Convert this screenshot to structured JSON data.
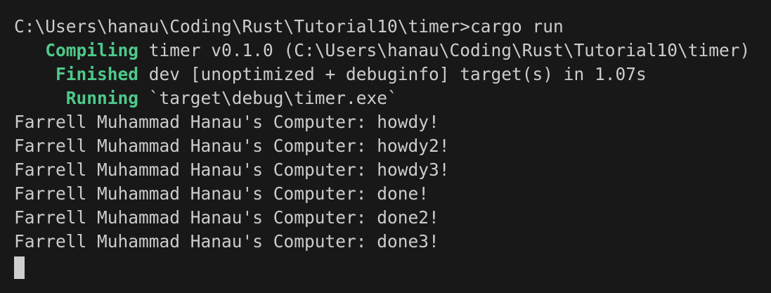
{
  "terminal": {
    "prompt": "C:\\Users\\hanau\\Coding\\Rust\\Tutorial10\\timer>cargo run",
    "cargo_lines": [
      {
        "indent": "   ",
        "status": "Compiling",
        "text": " timer v0.1.0 (C:\\Users\\hanau\\Coding\\Rust\\Tutorial10\\timer)"
      },
      {
        "indent": "    ",
        "status": "Finished",
        "text": " dev [unoptimized + debuginfo] target(s) in 1.07s"
      },
      {
        "indent": "     ",
        "status": "Running",
        "text": " `target\\debug\\timer.exe`"
      }
    ],
    "output_lines": [
      "Farrell Muhammad Hanau's Computer: howdy!",
      "Farrell Muhammad Hanau's Computer: howdy2!",
      "Farrell Muhammad Hanau's Computer: howdy3!",
      "Farrell Muhammad Hanau's Computer: done!",
      "Farrell Muhammad Hanau's Computer: done2!",
      "Farrell Muhammad Hanau's Computer: done3!"
    ],
    "colors": {
      "background": "#181818",
      "text": "#cccccc",
      "status": "#4ec98a",
      "cursor": "#cfcfcf"
    }
  }
}
